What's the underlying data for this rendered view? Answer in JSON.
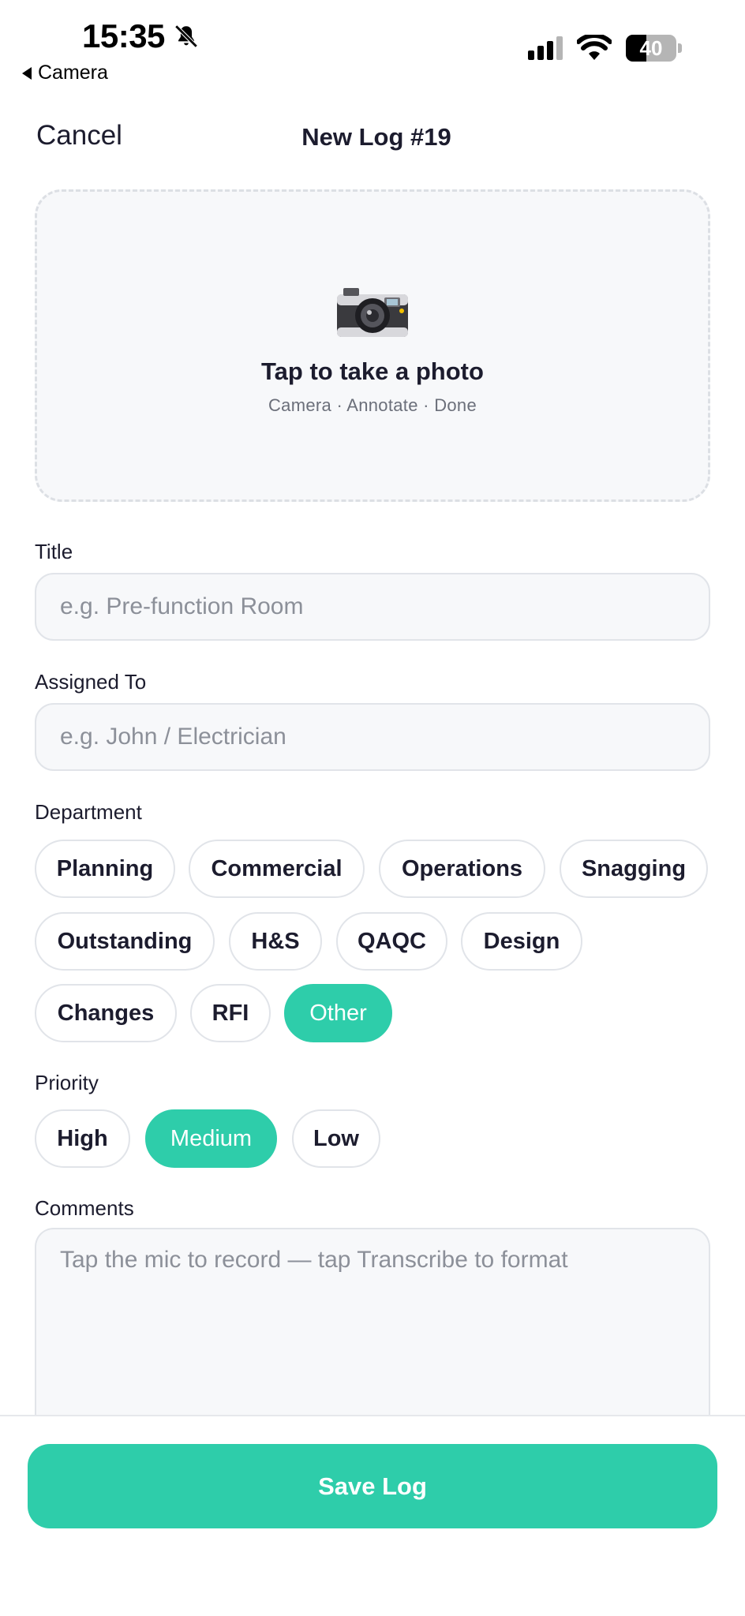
{
  "status_bar": {
    "time": "15:35",
    "back_app": "Camera",
    "battery_level": "40",
    "icons": [
      "bell-slash-icon",
      "cellular-signal-icon",
      "wifi-icon",
      "battery-icon"
    ]
  },
  "nav": {
    "cancel_label": "Cancel",
    "title": "New Log #19"
  },
  "photo": {
    "icon": "camera-icon",
    "title": "Tap to take a photo",
    "subtitle": "Camera · Annotate · Done"
  },
  "fields": {
    "title_label": "Title",
    "title_placeholder": "e.g. Pre-function Room",
    "title_value": "",
    "assigned_label": "Assigned To",
    "assigned_placeholder": "e.g. John / Electrician",
    "assigned_value": ""
  },
  "department": {
    "label": "Department",
    "options": [
      "Planning",
      "Commercial",
      "Operations",
      "Snagging",
      "Outstanding",
      "H&S",
      "QAQC",
      "Design",
      "Changes",
      "RFI",
      "Other"
    ],
    "selected": "Other"
  },
  "priority": {
    "label": "Priority",
    "options": [
      "High",
      "Medium",
      "Low"
    ],
    "selected": "Medium"
  },
  "comments": {
    "label": "Comments",
    "placeholder": "Tap the mic to record — tap Transcribe to format",
    "value": ""
  },
  "footer": {
    "save_label": "Save Log"
  },
  "colors": {
    "accent": "#2ecdaa",
    "text": "#1c1c2e",
    "muted": "#8c9099",
    "field_bg": "#f7f8fa",
    "border": "#e1e4e9"
  }
}
